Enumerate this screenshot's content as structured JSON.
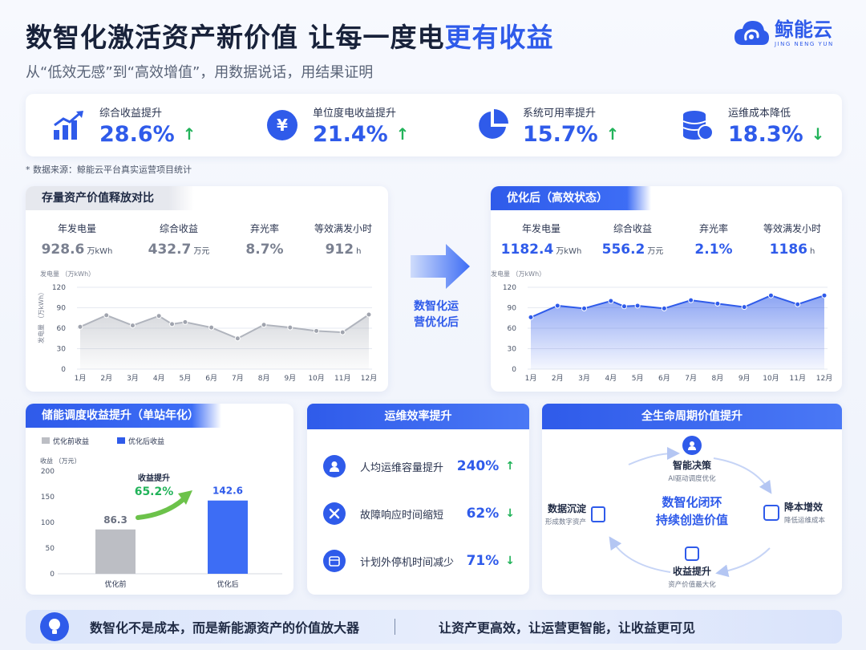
{
  "header": {
    "title_part1": "数智化激活资产新价值  让每一度电",
    "title_part2": "更有收益",
    "subtitle": "从“低效无感”到“高效增值”，用数据说话，用结果证明"
  },
  "brand": {
    "name": "鲸能云",
    "pinyin": "JING NENG YUN"
  },
  "kpis": [
    {
      "label": "综合收益提升",
      "value": "28.6%",
      "arrow": "↑",
      "icon": "growth-chart-icon"
    },
    {
      "label": "单位度电收益提升",
      "value": "21.4%",
      "arrow": "↑",
      "icon": "yen-coin-icon"
    },
    {
      "label": "系统可用率提升",
      "value": "15.7%",
      "arrow": "↑",
      "icon": "pie-chart-icon"
    },
    {
      "label": "运维成本降低",
      "value": "18.3%",
      "arrow": "↓",
      "icon": "coin-stack-icon"
    }
  ],
  "note": "* 数据来源：鲸能云平台真实运营项目统计",
  "before": {
    "tab": "存量资产价值释放对比",
    "stats": [
      {
        "label": "年发电量",
        "value": "928.6",
        "unit": "万kWh"
      },
      {
        "label": "综合收益",
        "value": "432.7",
        "unit": "万元"
      },
      {
        "label": "弃光率",
        "value": "8.7%",
        "unit": ""
      },
      {
        "label": "等效满发小时",
        "value": "912",
        "unit": "h"
      }
    ]
  },
  "middle": {
    "label_line1": "数智化运",
    "label_line2": "营优化后"
  },
  "after": {
    "tab": "优化后（高效状态）",
    "stats": [
      {
        "label": "年发电量",
        "value": "1182.4",
        "unit": "万kWh"
      },
      {
        "label": "综合收益",
        "value": "556.2",
        "unit": "万元"
      },
      {
        "label": "弃光率",
        "value": "2.1%",
        "unit": ""
      },
      {
        "label": "等效满发小时",
        "value": "1186",
        "unit": "h"
      }
    ]
  },
  "chart_data": [
    {
      "type": "area",
      "title": "",
      "ylabel": "发电量 （万kWh）",
      "ylabel_rotated": "发电量 （万kWh）",
      "categories": [
        "1月",
        "2月",
        "3月",
        "4月",
        "5月",
        "6月",
        "7月",
        "8月",
        "9月",
        "10月",
        "11月",
        "12月"
      ],
      "x": [
        1,
        2,
        3,
        4,
        5,
        6,
        7,
        8,
        9,
        10,
        11,
        12,
        4.5
      ],
      "y_ticks": [
        0,
        30,
        60,
        90,
        120
      ],
      "ylim": [
        0,
        120
      ],
      "series": [
        {
          "values": [
            62,
            79,
            64,
            78,
            69,
            61,
            45,
            65,
            61,
            56,
            54,
            80
          ]
        }
      ],
      "extra_points": [
        {
          "x": 4.5,
          "y": 66
        }
      ],
      "color": "#b0b4bd",
      "grid": true
    },
    {
      "type": "area",
      "title": "",
      "ylabel": "发电量 （万kWh）",
      "categories": [
        "1月",
        "2月",
        "3月",
        "4月",
        "5月",
        "6月",
        "7月",
        "8月",
        "9月",
        "10月",
        "11月",
        "12月"
      ],
      "y_ticks": [
        0,
        30,
        60,
        90,
        120
      ],
      "ylim": [
        0,
        120
      ],
      "series": [
        {
          "values": [
            76,
            93,
            89,
            100,
            92,
            93,
            89,
            101,
            96,
            91,
            108,
            95,
            108
          ]
        }
      ],
      "x": [
        1,
        2,
        3,
        4,
        4.5,
        5,
        6,
        7,
        8,
        9,
        10,
        11,
        12
      ],
      "color": "#2f5bea",
      "grid": true
    },
    {
      "type": "bar",
      "title": "储能调度收益提升（单站年化）",
      "ylabel": "收益 （万元）",
      "categories": [
        "优化前",
        "优化后"
      ],
      "values": [
        86.3,
        142.6
      ],
      "value_labels": [
        "86.3",
        "142.6"
      ],
      "legend": [
        "优化前收益",
        "优化后收益"
      ],
      "y_ticks": [
        0,
        50,
        100,
        150,
        200
      ],
      "ylim": [
        0,
        200
      ],
      "annotation": {
        "label": "收益提升",
        "value": "65.2%"
      }
    }
  ],
  "efficiency": {
    "title": "运维效率提升",
    "rows": [
      {
        "label": "人均运维容量提升",
        "value": "240%",
        "arrow": "↑",
        "icon": "user-icon"
      },
      {
        "label": "故障响应时间缩短",
        "value": "62%",
        "arrow": "↓",
        "icon": "wrench-icon"
      },
      {
        "label": "计划外停机时间减少",
        "value": "71%",
        "arrow": "↓",
        "icon": "calendar-icon"
      }
    ]
  },
  "lifecycle": {
    "title": "全生命周期价值提升",
    "center_line1": "数智化闭环",
    "center_line2": "持续创造价值",
    "nodes": {
      "top": {
        "title": "智能决策",
        "sub": "AI驱动调度优化"
      },
      "right": {
        "title": "降本增效",
        "sub": "降低运维成本"
      },
      "bottom": {
        "title": "收益提升",
        "sub": "资产价值最大化"
      },
      "left": {
        "title": "数据沉淀",
        "sub": "形成数字资产"
      }
    }
  },
  "banner": {
    "left": "数智化不是成本，而是新能源资产的价值放大器",
    "right": "让资产更高效，让运营更智能，让收益更可见"
  }
}
